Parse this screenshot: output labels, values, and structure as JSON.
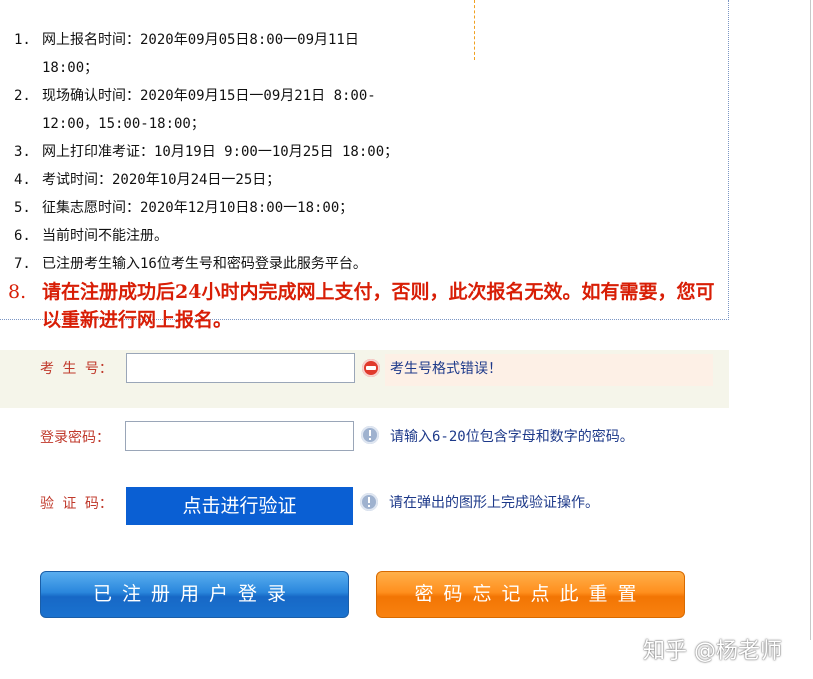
{
  "notice": {
    "items": [
      {
        "num": "1.",
        "text": "网上报名时间：2020年09月05日8:00一09月11日 18:00；"
      },
      {
        "num": "2.",
        "text": "现场确认时间：2020年09月15日一09月21日 8:00-12:00，15:00-18:00；"
      },
      {
        "num": "3.",
        "text": "网上打印准考证：10月19日 9:00一10月25日 18:00；"
      },
      {
        "num": "4.",
        "text": "考试时间：2020年10月24日一25日；"
      },
      {
        "num": "5.",
        "text": "征集志愿时间：2020年12月10日8:00一18:00；"
      },
      {
        "num": "6.",
        "text": "当前时间不能注册。"
      },
      {
        "num": "7.",
        "text": "已注册考生输入16位考生号和密码登录此服务平台。"
      }
    ],
    "warning": {
      "num": "8.",
      "text": "请在注册成功后24小时内完成网上支付，否则，此次报名无效。如有需要，您可以重新进行网上报名。"
    }
  },
  "form": {
    "exam_no": {
      "label": "考 生 号：",
      "value": "",
      "hint": "考生号格式错误！"
    },
    "password": {
      "label": "登录密码：",
      "value": "",
      "hint": "请输入6-20位包含字母和数字的密码。"
    },
    "captcha": {
      "label": "验 证 码：",
      "button": "点击进行验证",
      "hint": "请在弹出的图形上完成验证操作。"
    }
  },
  "buttons": {
    "login": "已注册用户登录",
    "reset": "密码忘记点此重置"
  },
  "watermark": "知乎 @杨老师",
  "colors": {
    "label_red": "#c0392b",
    "hint_blue": "#1e3a8a",
    "warning_red": "#d81e06",
    "verify_blue": "#0a5fd3",
    "login_blue": "#2a87dc",
    "reset_orange": "#ff8f1e",
    "error_icon": "#e03a2d",
    "info_icon": "#9fb2cf"
  }
}
